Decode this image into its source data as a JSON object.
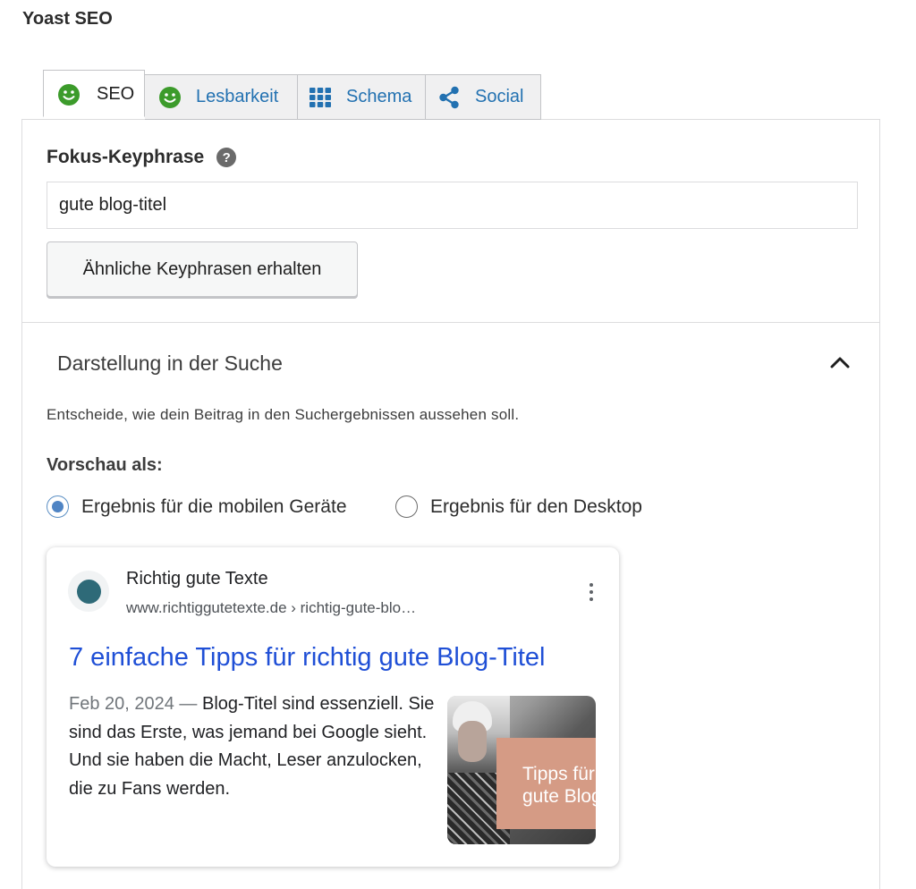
{
  "metabox": {
    "title": "Yoast SEO"
  },
  "tabs": [
    {
      "label": "SEO",
      "icon": "smiley-icon",
      "active": true
    },
    {
      "label": "Lesbarkeit",
      "icon": "smiley-icon",
      "active": false
    },
    {
      "label": "Schema",
      "icon": "grid-icon",
      "active": false
    },
    {
      "label": "Social",
      "icon": "share-icon",
      "active": false
    }
  ],
  "colors": {
    "smiley_green": "#3c9b2b",
    "link_blue": "#2271b1",
    "result_title": "#1f4fd6",
    "thumb_overlay": "#d59b85"
  },
  "focus": {
    "label": "Fokus-Keyphrase",
    "help": "?",
    "value": "gute blog-titel",
    "related_button": "Ähnliche Keyphrasen erhalten"
  },
  "search_appearance": {
    "title": "Darstellung in der Suche",
    "description": "Entscheide, wie dein Beitrag in den Suchergebnissen aussehen soll.",
    "preview_label": "Vorschau als:",
    "options": [
      {
        "label": "Ergebnis für die mobilen Geräte",
        "checked": true
      },
      {
        "label": "Ergebnis für den Desktop",
        "checked": false
      }
    ]
  },
  "preview": {
    "site_name": "Richtig gute Texte",
    "url": "www.richtiggutetexte.de › richtig-gute-blo…",
    "title": "7 einfache Tipps für richtig gute Blog-Titel",
    "date": "Feb 20, 2024",
    "separator": " — ",
    "snippet": "Blog-Titel sind essenziell. Sie sind das Erste, was jemand bei Google sieht. Und sie haben die Macht, Leser anzulocken, die zu Fans werden.",
    "thumb_line1": "Tipps für r",
    "thumb_line2": "gute Blog"
  }
}
